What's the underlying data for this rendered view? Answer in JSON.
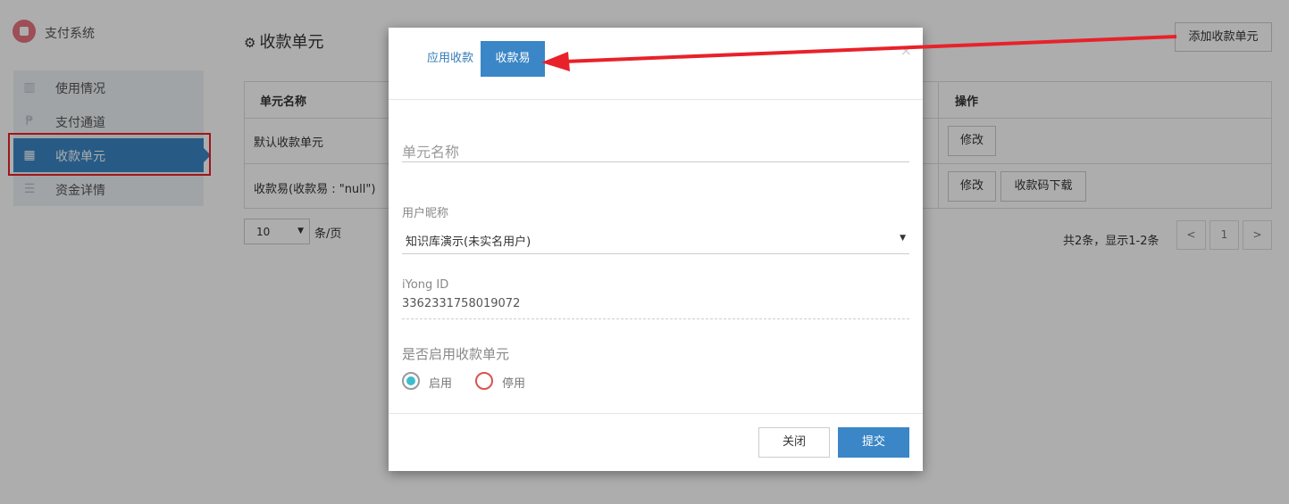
{
  "app": {
    "title": "支付系统"
  },
  "sidebar": {
    "items": [
      {
        "label": "使用情况",
        "icon": "bar-chart-icon"
      },
      {
        "label": "支付通道",
        "icon": "paypal-icon"
      },
      {
        "label": "收款单元",
        "icon": "grid-icon",
        "active": true
      },
      {
        "label": "资金详情",
        "icon": "list-icon"
      }
    ]
  },
  "page": {
    "title": "收款单元",
    "add_button": "添加收款单元",
    "table": {
      "headers": {
        "name": "单元名称",
        "actions": "操作"
      },
      "rows": [
        {
          "name": "默认收款单元",
          "actions": [
            "修改"
          ]
        },
        {
          "name": "收款易(收款易 : \"null\")",
          "actions": [
            "修改",
            "收款码下载"
          ]
        }
      ]
    },
    "pagination": {
      "page_size": "10",
      "per_page_label": "条/页",
      "summary": "共2条，显示1-2条",
      "prev": "<",
      "current": "1",
      "next": ">"
    }
  },
  "modal": {
    "tabs": [
      {
        "label": "应用收款",
        "active": false
      },
      {
        "label": "收款易",
        "active": true
      }
    ],
    "close_icon": "×",
    "unit_name_placeholder": "单元名称",
    "nickname_label": "用户昵称",
    "nickname_value": "知识库演示(未实名用户)",
    "iyong_label": "iYong ID",
    "iyong_value": "3362331758019072",
    "enable_label": "是否启用收款单元",
    "radio_on": "启用",
    "radio_off": "停用",
    "close_button": "关闭",
    "submit_button": "提交"
  },
  "colors": {
    "accent": "#3a86c6",
    "annotation": "#e8212a"
  }
}
